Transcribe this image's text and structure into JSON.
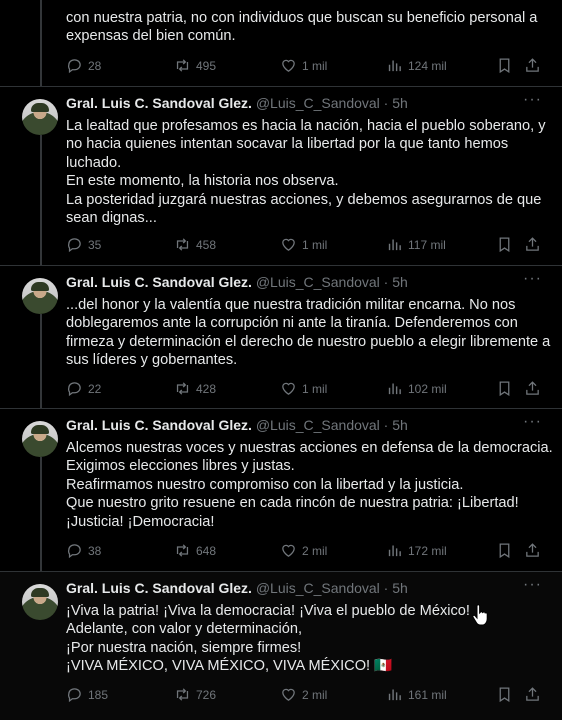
{
  "tweets": [
    {
      "lines": [
        "con nuestra patria, no con individuos que buscan su beneficio personal a",
        "expensas del bien común."
      ],
      "replies": "28",
      "reposts": "495",
      "likes": "1 mil",
      "views": "124 mil"
    },
    {
      "name": "Gral. Luis C. Sandoval Glez.",
      "handle": "@Luis_C_Sandoval · 5h",
      "lines": [
        "La lealtad que profesamos es hacia la nación, hacia el pueblo soberano, y",
        "no hacia quienes intentan socavar la libertad por la que tanto hemos",
        "luchado.",
        "En este momento, la historia nos observa.",
        "La posteridad juzgará nuestras acciones, y debemos asegurarnos de que",
        "sean dignas..."
      ],
      "replies": "35",
      "reposts": "458",
      "likes": "1 mil",
      "views": "117 mil"
    },
    {
      "name": "Gral. Luis C. Sandoval Glez.",
      "handle": "@Luis_C_Sandoval · 5h",
      "lines": [
        "...del honor y la valentía que nuestra tradición militar encarna. No nos",
        "doblegaremos ante la corrupción ni ante la tiranía. Defenderemos con",
        "firmeza y determinación el derecho de nuestro pueblo a elegir libremente a",
        "sus líderes y gobernantes."
      ],
      "replies": "22",
      "reposts": "428",
      "likes": "1 mil",
      "views": "102 mil"
    },
    {
      "name": "Gral. Luis C. Sandoval Glez.",
      "handle": "@Luis_C_Sandoval · 5h",
      "lines": [
        "Alcemos nuestras voces y nuestras acciones en defensa de la democracia.",
        "Exigimos elecciones libres y justas.",
        "Reafirmamos nuestro compromiso con la libertad y la justicia.",
        "Que nuestro grito resuene en cada rincón de nuestra patria: ¡Libertad!",
        "¡Justicia! ¡Democracia!"
      ],
      "replies": "38",
      "reposts": "648",
      "likes": "2 mil",
      "views": "172 mil"
    },
    {
      "name": "Gral. Luis C. Sandoval Glez.",
      "handle": "@Luis_C_Sandoval · 5h",
      "lines": [
        "¡Viva la patria! ¡Viva la democracia! ¡Viva el pueblo de México!",
        "Adelante, con valor y determinación,",
        "¡Por nuestra nación, siempre firmes!",
        "¡VIVA MÉXICO, VIVA MÉXICO, VIVA MÉXICO! 🇲🇽"
      ],
      "replies": "185",
      "reposts": "726",
      "likes": "2 mil",
      "views": "161 mil"
    }
  ]
}
